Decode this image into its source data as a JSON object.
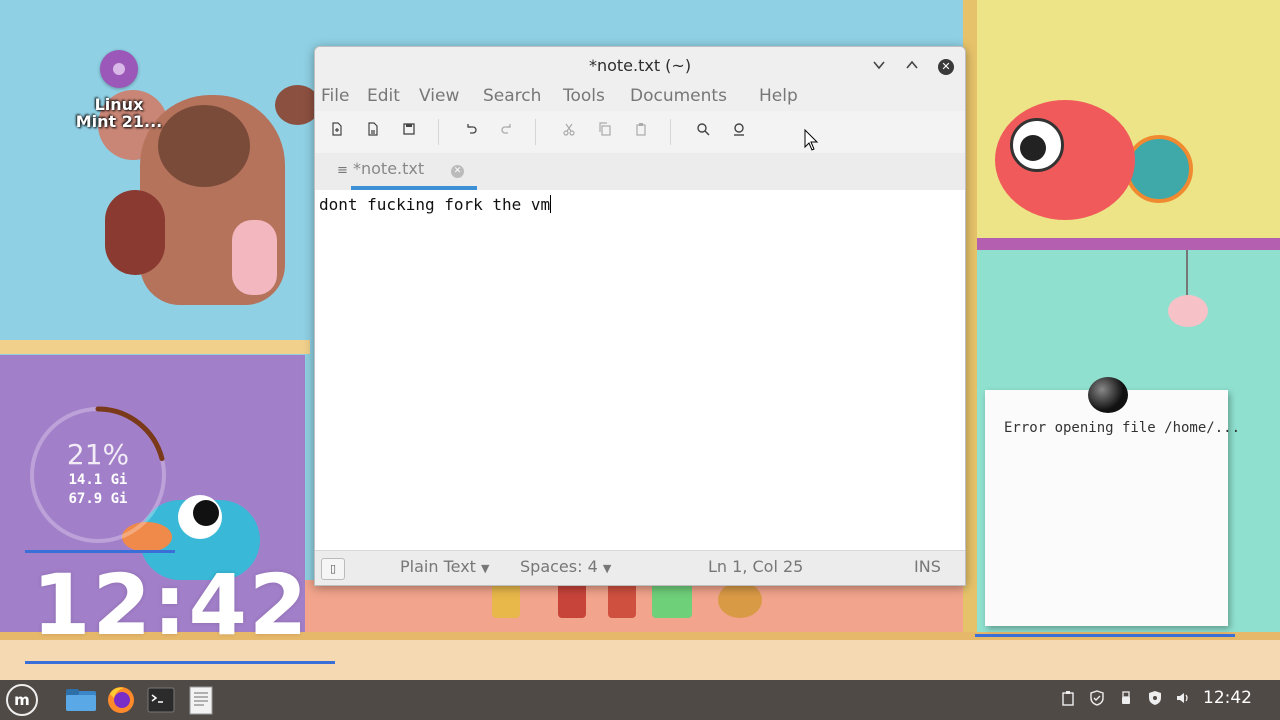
{
  "desktop": {
    "icon_label_line1": "Linux",
    "icon_label_line2": "Mint 21...",
    "gauge": {
      "percent_text": "21%",
      "percent_value": 0.21,
      "line1": "14.1 Gi",
      "line2": "67.9 Gi"
    },
    "big_clock": "12:42",
    "sticky_note_text": "Error opening file /home/..."
  },
  "window": {
    "title": "*note.txt (~)",
    "menus": [
      "File",
      "Edit",
      "View",
      "Search",
      "Tools",
      "Documents",
      "Help"
    ],
    "tab_label": "*note.txt",
    "editor_content": "dont fucking fork the vm",
    "status": {
      "language": "Plain Text",
      "spaces": "Spaces: 4",
      "position": "Ln 1, Col 25",
      "mode": "INS"
    }
  },
  "taskbar": {
    "clock": "12:42",
    "apps": [
      "menu-icon",
      "file-manager-icon",
      "firefox-icon",
      "terminal-icon",
      "text-editor-icon"
    ],
    "tray": [
      "clipboard-icon",
      "update-shield-icon",
      "usb-icon",
      "vpn-shield-icon",
      "volume-icon"
    ]
  },
  "colors": {
    "tab_accent": "#3d8fd6",
    "taskbar_bg": "#504a46",
    "gauge_arc": "#7a3a1a"
  }
}
